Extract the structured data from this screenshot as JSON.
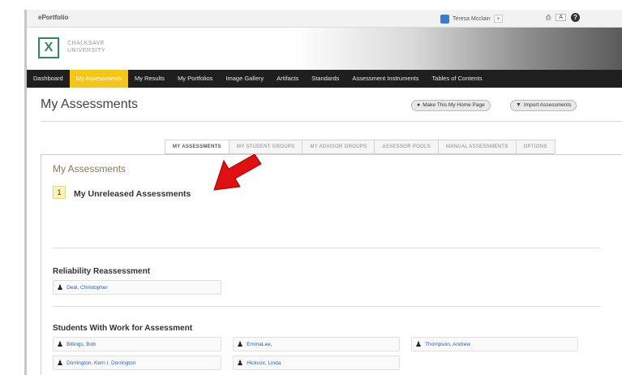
{
  "topbar": {
    "app_name": "ePortfolio",
    "user": "Teresa Mcclain",
    "user_menu": "▾",
    "tools": {
      "print": "⎙",
      "font_size": "A",
      "help": "?"
    }
  },
  "brand": {
    "logo_mark": "X",
    "university_line1": "CHALKSAVE",
    "university_line2": "UNIVERSITY"
  },
  "nav": [
    "Dashboard",
    "My Assessments",
    "My Results",
    "My Portfolios",
    "Image Gallery",
    "Artifacts",
    "Standards",
    "Assessment Instruments",
    "Tables of Contents"
  ],
  "page": {
    "title": "My Assessments",
    "home_button": "Make This My Home Page",
    "import_button": "Import Assessments"
  },
  "tabs": [
    "MY ASSESSMENTS",
    "MY STUDENT GROUPS",
    "MY ADVISOR GROUPS",
    "ASSESSOR POOLS",
    "MANUAL ASSESSMENTS",
    "OPTIONS"
  ],
  "panel": {
    "title": "My Assessments",
    "unreleased_count": "1",
    "unreleased_label": "My Unreleased Assessments"
  },
  "reliability": {
    "title": "Reliability Reassessment",
    "people": [
      "Deal, Christopher"
    ]
  },
  "students": {
    "title": "Students With Work for Assessment",
    "people": [
      "Billings, Bob",
      "EmmaLee,",
      "Thompson, Andrew",
      "Dorrington, Kerri I. Dorrington",
      "Hickcox, Linda"
    ]
  },
  "colors": {
    "nav_active": "#f5c518",
    "link": "#2a62b8",
    "arrow": "#e01010"
  }
}
